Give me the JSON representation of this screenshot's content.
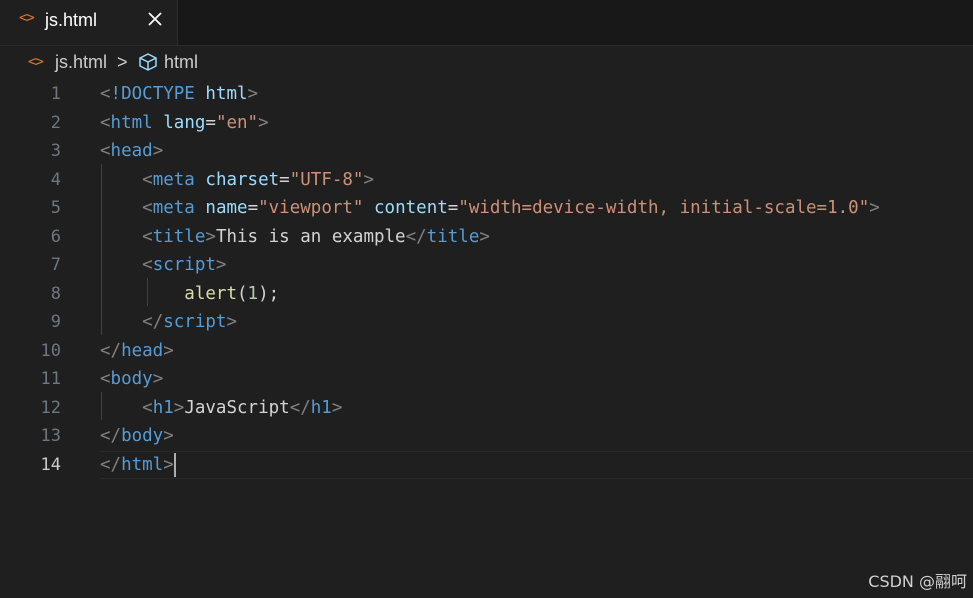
{
  "tab": {
    "icon": "html-file-icon",
    "label": "js.html",
    "close_icon": "close-icon"
  },
  "breadcrumb": {
    "file": "js.html",
    "separator": ">",
    "symbol": "html"
  },
  "editor": {
    "active_line": 14,
    "lines": [
      [
        {
          "t": "punct",
          "v": "<"
        },
        {
          "t": "tag",
          "v": "!DOCTYPE"
        },
        {
          "t": "text",
          "v": " "
        },
        {
          "t": "attr",
          "v": "html"
        },
        {
          "t": "punct",
          "v": ">"
        }
      ],
      [
        {
          "t": "punct",
          "v": "<"
        },
        {
          "t": "tag",
          "v": "html"
        },
        {
          "t": "text",
          "v": " "
        },
        {
          "t": "attr",
          "v": "lang"
        },
        {
          "t": "text",
          "v": "="
        },
        {
          "t": "str",
          "v": "\"en\""
        },
        {
          "t": "punct",
          "v": ">"
        }
      ],
      [
        {
          "t": "punct",
          "v": "<"
        },
        {
          "t": "tag",
          "v": "head"
        },
        {
          "t": "punct",
          "v": ">"
        }
      ],
      [
        {
          "t": "text",
          "v": "    "
        },
        {
          "t": "punct",
          "v": "<"
        },
        {
          "t": "tag",
          "v": "meta"
        },
        {
          "t": "text",
          "v": " "
        },
        {
          "t": "attr",
          "v": "charset"
        },
        {
          "t": "text",
          "v": "="
        },
        {
          "t": "str",
          "v": "\"UTF-8\""
        },
        {
          "t": "punct",
          "v": ">"
        }
      ],
      [
        {
          "t": "text",
          "v": "    "
        },
        {
          "t": "punct",
          "v": "<"
        },
        {
          "t": "tag",
          "v": "meta"
        },
        {
          "t": "text",
          "v": " "
        },
        {
          "t": "attr",
          "v": "name"
        },
        {
          "t": "text",
          "v": "="
        },
        {
          "t": "str",
          "v": "\"viewport\""
        },
        {
          "t": "text",
          "v": " "
        },
        {
          "t": "attr",
          "v": "content"
        },
        {
          "t": "text",
          "v": "="
        },
        {
          "t": "str",
          "v": "\"width=device-width, initial-scale=1.0\""
        },
        {
          "t": "punct",
          "v": ">"
        }
      ],
      [
        {
          "t": "text",
          "v": "    "
        },
        {
          "t": "punct",
          "v": "<"
        },
        {
          "t": "tag",
          "v": "title"
        },
        {
          "t": "punct",
          "v": ">"
        },
        {
          "t": "text",
          "v": "This is an example"
        },
        {
          "t": "punct",
          "v": "</"
        },
        {
          "t": "tag",
          "v": "title"
        },
        {
          "t": "punct",
          "v": ">"
        }
      ],
      [
        {
          "t": "text",
          "v": "    "
        },
        {
          "t": "punct",
          "v": "<"
        },
        {
          "t": "tag",
          "v": "script"
        },
        {
          "t": "punct",
          "v": ">"
        }
      ],
      [
        {
          "t": "text",
          "v": "        "
        },
        {
          "t": "fn",
          "v": "alert"
        },
        {
          "t": "text",
          "v": "("
        },
        {
          "t": "num",
          "v": "1"
        },
        {
          "t": "text",
          "v": ");"
        }
      ],
      [
        {
          "t": "text",
          "v": "    "
        },
        {
          "t": "punct",
          "v": "</"
        },
        {
          "t": "tag",
          "v": "script"
        },
        {
          "t": "punct",
          "v": ">"
        }
      ],
      [
        {
          "t": "punct",
          "v": "</"
        },
        {
          "t": "tag",
          "v": "head"
        },
        {
          "t": "punct",
          "v": ">"
        }
      ],
      [
        {
          "t": "punct",
          "v": "<"
        },
        {
          "t": "tag",
          "v": "body"
        },
        {
          "t": "punct",
          "v": ">"
        }
      ],
      [
        {
          "t": "text",
          "v": "    "
        },
        {
          "t": "punct",
          "v": "<"
        },
        {
          "t": "tag",
          "v": "h1"
        },
        {
          "t": "punct",
          "v": ">"
        },
        {
          "t": "text",
          "v": "JavaScript"
        },
        {
          "t": "punct",
          "v": "</"
        },
        {
          "t": "tag",
          "v": "h1"
        },
        {
          "t": "punct",
          "v": ">"
        }
      ],
      [
        {
          "t": "punct",
          "v": "</"
        },
        {
          "t": "tag",
          "v": "body"
        },
        {
          "t": "punct",
          "v": ">"
        }
      ],
      [
        {
          "t": "punct",
          "v": "</"
        },
        {
          "t": "tag",
          "v": "html"
        },
        {
          "t": "punct",
          "v": ">"
        }
      ]
    ]
  },
  "watermark": "CSDN @翮呵",
  "colors": {
    "background": "#1f1f1f",
    "tag": "#569cd6",
    "attribute": "#9cdcfe",
    "string": "#ce9178",
    "function": "#dcdcaa",
    "number": "#b5cea8",
    "file_icon": "#e37933"
  }
}
